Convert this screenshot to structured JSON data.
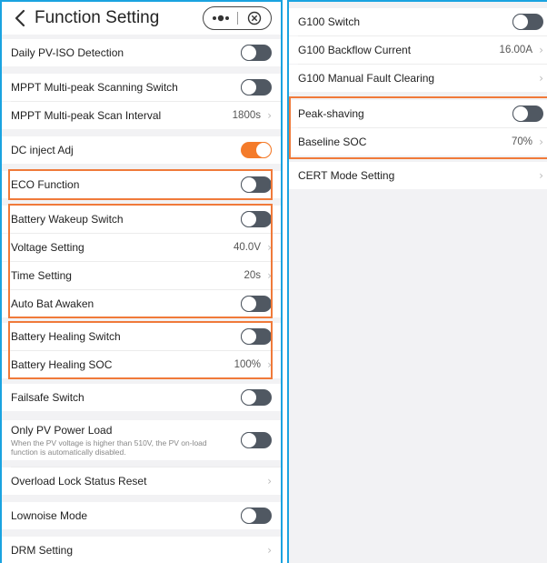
{
  "left": {
    "header": {
      "title": "Function Setting",
      "capsule_dots": "•●•",
      "capsule_close": "⊗"
    },
    "rows": {
      "pviso": {
        "label": "Daily PV-ISO Detection",
        "toggle": "off"
      },
      "mppt_switch": {
        "label": "MPPT Multi-peak Scanning Switch",
        "toggle": "off"
      },
      "mppt_interval": {
        "label": "MPPT Multi-peak Scan Interval",
        "value": "1800s"
      },
      "dc_inject": {
        "label": "DC inject Adj",
        "toggle": "on"
      },
      "eco": {
        "label": "ECO Function",
        "toggle": "off"
      },
      "wakeup": {
        "label": "Battery Wakeup Switch",
        "toggle": "off"
      },
      "voltage": {
        "label": "Voltage Setting",
        "value": "40.0V"
      },
      "time": {
        "label": "Time Setting",
        "value": "20s"
      },
      "auto_bat": {
        "label": "Auto Bat Awaken",
        "toggle": "off"
      },
      "healing": {
        "label": "Battery Healing Switch",
        "toggle": "off"
      },
      "healing_soc": {
        "label": "Battery Healing SOC",
        "value": "100%"
      },
      "failsafe": {
        "label": "Failsafe Switch",
        "toggle": "off"
      },
      "pv_load": {
        "label": "Only PV Power Load",
        "sub": "When the PV voltage is higher than 510V, the PV on-load function is automatically disabled.",
        "toggle": "off"
      },
      "overload": {
        "label": "Overload Lock Status Reset"
      },
      "lownoise": {
        "label": "Lownoise Mode",
        "toggle": "off"
      },
      "drm": {
        "label": "DRM Setting"
      }
    }
  },
  "right": {
    "rows": {
      "g100_switch": {
        "label": "G100 Switch",
        "toggle": "off"
      },
      "g100_backflow": {
        "label": "G100 Backflow Current",
        "value": "16.00A"
      },
      "g100_fault": {
        "label": "G100 Manual Fault Clearing"
      },
      "peak_shaving": {
        "label": "Peak-shaving",
        "toggle": "off"
      },
      "baseline_soc": {
        "label": "Baseline SOC",
        "value": "70%"
      },
      "cert_mode": {
        "label": "CERT Mode Setting"
      }
    }
  },
  "chevron": "›",
  "colors": {
    "accent": "#f47b2a",
    "frame": "#1aa3e0",
    "toggle_off": "#505862",
    "highlight": "#f07a3a"
  }
}
